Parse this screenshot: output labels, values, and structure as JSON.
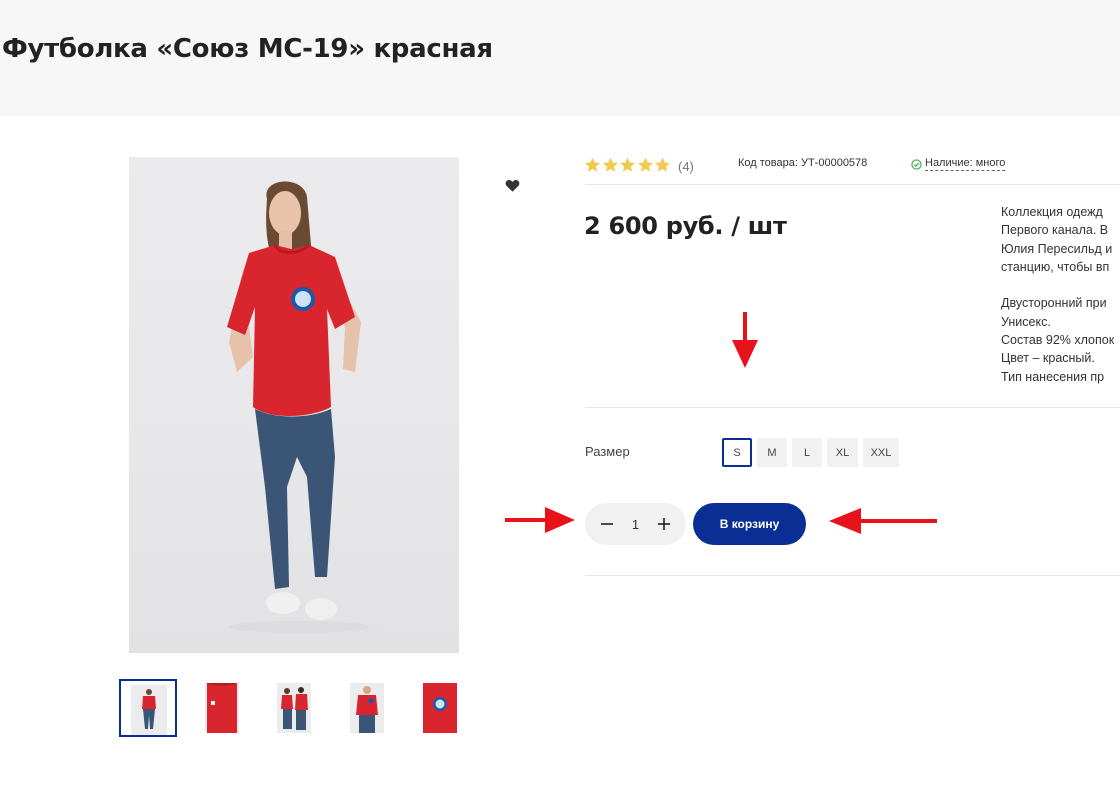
{
  "product": {
    "title": "Футболка «Союз МС-19» красная",
    "rating_count": "(4)",
    "sku": "Код товара: УТ-00000578",
    "stock": "Наличие: много",
    "price": "2 600 руб. / шт",
    "description": [
      "Коллекция одежд",
      "Первого канала. В",
      "Юлия Пересильд и",
      "станцию, чтобы вп",
      "",
      "Двусторонний при",
      "Унисекс.",
      "Состав 92% хлопок",
      "Цвет – красный.",
      "Тип нанесения пр"
    ],
    "size_label": "Размер",
    "sizes": [
      "S",
      "M",
      "L",
      "XL",
      "XXL"
    ],
    "selected_size": "S",
    "quantity": "1",
    "cart_button": "В корзину"
  },
  "colors": {
    "accent": "#0a2f94",
    "star": "#f2c94c",
    "arrow": "#e8121a",
    "shirt": "#d8252e",
    "stock_check": "#3fae4a"
  }
}
